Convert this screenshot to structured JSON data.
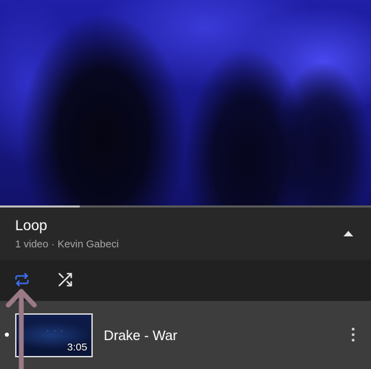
{
  "player": {
    "progress_fraction": 0.215
  },
  "playlist": {
    "title": "Loop",
    "meta": "1 video · Kevin Gabeci",
    "collapse_icon": "chevron-up-icon"
  },
  "controls": {
    "loop_icon": "loop-icon",
    "loop_active_color": "#3e6ff5",
    "shuffle_icon": "shuffle-icon"
  },
  "items": [
    {
      "title": "Drake - War",
      "duration": "3:05",
      "now_playing": true
    }
  ],
  "annotation": {
    "arrow_color": "#9a7a86"
  }
}
